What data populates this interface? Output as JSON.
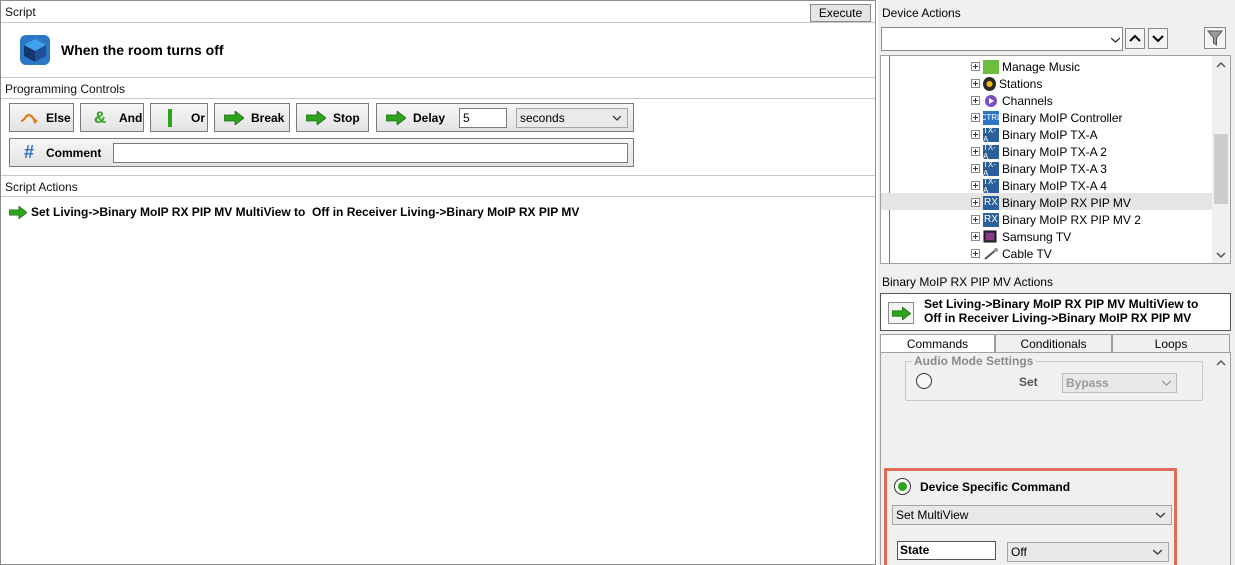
{
  "script": {
    "header": "Script",
    "execute_label": "Execute",
    "title": "When the room turns off"
  },
  "programming": {
    "header": "Programming Controls",
    "else_label": "Else",
    "and_label": "And",
    "or_label": "Or",
    "break_label": "Break",
    "stop_label": "Stop",
    "delay_label": "Delay",
    "delay_value": "5",
    "delay_unit": "seconds",
    "comment_label": "Comment",
    "comment_value": ""
  },
  "script_actions": {
    "header": "Script Actions",
    "items": [
      "Set Living->Binary MoIP RX PIP MV MultiView to  Off in Receiver Living->Binary MoIP RX PIP MV"
    ]
  },
  "device_actions": {
    "header": "Device Actions",
    "filter_value": "",
    "tree": [
      {
        "label": "Manage Music",
        "icon": "music-icon"
      },
      {
        "label": "Stations",
        "icon": "stations-icon"
      },
      {
        "label": "Channels",
        "icon": "channels-icon"
      },
      {
        "label": "Binary MoIP Controller",
        "icon": "ctrl-icon"
      },
      {
        "label": "Binary MoIP TX-A",
        "icon": "tx-icon"
      },
      {
        "label": "Binary MoIP TX-A 2",
        "icon": "tx-icon"
      },
      {
        "label": "Binary MoIP TX-A 3",
        "icon": "tx-icon"
      },
      {
        "label": "Binary MoIP TX-A 4",
        "icon": "tx-icon"
      },
      {
        "label": "Binary MoIP RX PIP MV",
        "icon": "rx-icon"
      },
      {
        "label": "Binary MoIP RX PIP MV 2",
        "icon": "rx-icon"
      },
      {
        "label": "Samsung TV",
        "icon": "tv-icon"
      },
      {
        "label": "Cable TV",
        "icon": "cable-icon"
      }
    ]
  },
  "actions_panel": {
    "header": "Binary MoIP RX PIP MV Actions",
    "preview_line1": "Set Living->Binary MoIP RX PIP MV MultiView to",
    "preview_line2": "Off in Receiver Living->Binary MoIP RX PIP MV",
    "tabs": [
      "Commands",
      "Conditionals",
      "Loops"
    ],
    "audio_group_label": "Audio Mode Settings",
    "audio_set_label": "Set",
    "audio_set_value": "Bypass",
    "device_cmd_label": "Device Specific Command",
    "device_cmd_value": "Set MultiView",
    "state_label": "State",
    "state_value": "Off"
  },
  "icon_text": {
    "ctrl": "CTRL",
    "tx": "TX-A",
    "rx": "RX"
  },
  "colors": {
    "arrow_green": "#2fa31e",
    "else_orange": "#e07a16",
    "highlight_box": "#e06c5c",
    "tree_selected": "#e5e5e5"
  }
}
